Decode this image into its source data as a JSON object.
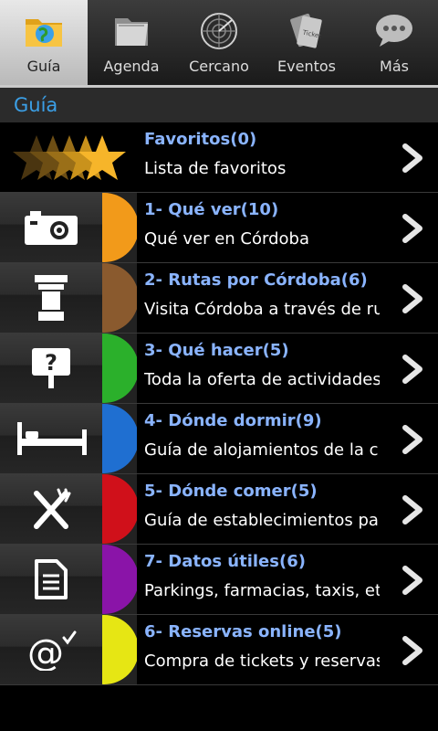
{
  "tabs": [
    {
      "label": "Guía",
      "icon": "folder-globe-icon",
      "active": true
    },
    {
      "label": "Agenda",
      "icon": "folder-icon",
      "active": false
    },
    {
      "label": "Cercano",
      "icon": "radar-icon",
      "active": false
    },
    {
      "label": "Eventos",
      "icon": "ticket-icon",
      "active": false
    },
    {
      "label": "Más",
      "icon": "chat-bubble-icon",
      "active": false
    }
  ],
  "section_title": "Guía",
  "items": [
    {
      "title": "Favoritos(0)",
      "subtitle": "Lista de favoritos",
      "icon": "stars-icon",
      "color": "#f4a623"
    },
    {
      "title": "1- Qué ver(10)",
      "subtitle": "Qué ver en Córdoba",
      "icon": "camera-icon",
      "color": "#f29a1a"
    },
    {
      "title": "2- Rutas por Córdoba(6)",
      "subtitle": "Visita Córdoba a través de rutas",
      "icon": "column-icon",
      "color": "#8a5a2e"
    },
    {
      "title": "3- Qué hacer(5)",
      "subtitle": "Toda la oferta de actividades",
      "icon": "question-sign-icon",
      "color": "#2bb02b"
    },
    {
      "title": "4- Dónde dormir(9)",
      "subtitle": "Guía de alojamientos de la ciudad",
      "icon": "bed-icon",
      "color": "#1f6fd1"
    },
    {
      "title": "5- Dónde comer(5)",
      "subtitle": "Guía de establecimientos para comer",
      "icon": "fork-knife-icon",
      "color": "#d0101a"
    },
    {
      "title": "7- Datos útiles(6)",
      "subtitle": "Parkings, farmacias, taxis, etc.",
      "icon": "document-icon",
      "color": "#8a14a8"
    },
    {
      "title": "6- Reservas online(5)",
      "subtitle": "Compra de tickets y reservas",
      "icon": "at-check-icon",
      "color": "#e6e614"
    }
  ]
}
